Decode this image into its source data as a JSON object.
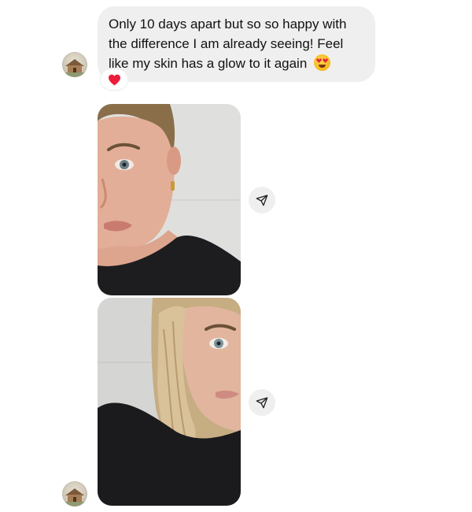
{
  "message": {
    "text": "Only 10 days apart but so so happy with the difference I am already seeing! Feel like my skin has a glow to it again",
    "emoji_icon": "heart-eyes-emoji",
    "reaction_icon": "red-heart-icon"
  },
  "photos": [
    {
      "icon": "share-icon",
      "description_icon": "selfie-photo"
    },
    {
      "icon": "share-icon",
      "description_icon": "selfie-photo"
    }
  ],
  "colors": {
    "bubble_bg": "#efefef",
    "reaction_heart": "#ee1d3b",
    "text": "#111111"
  }
}
